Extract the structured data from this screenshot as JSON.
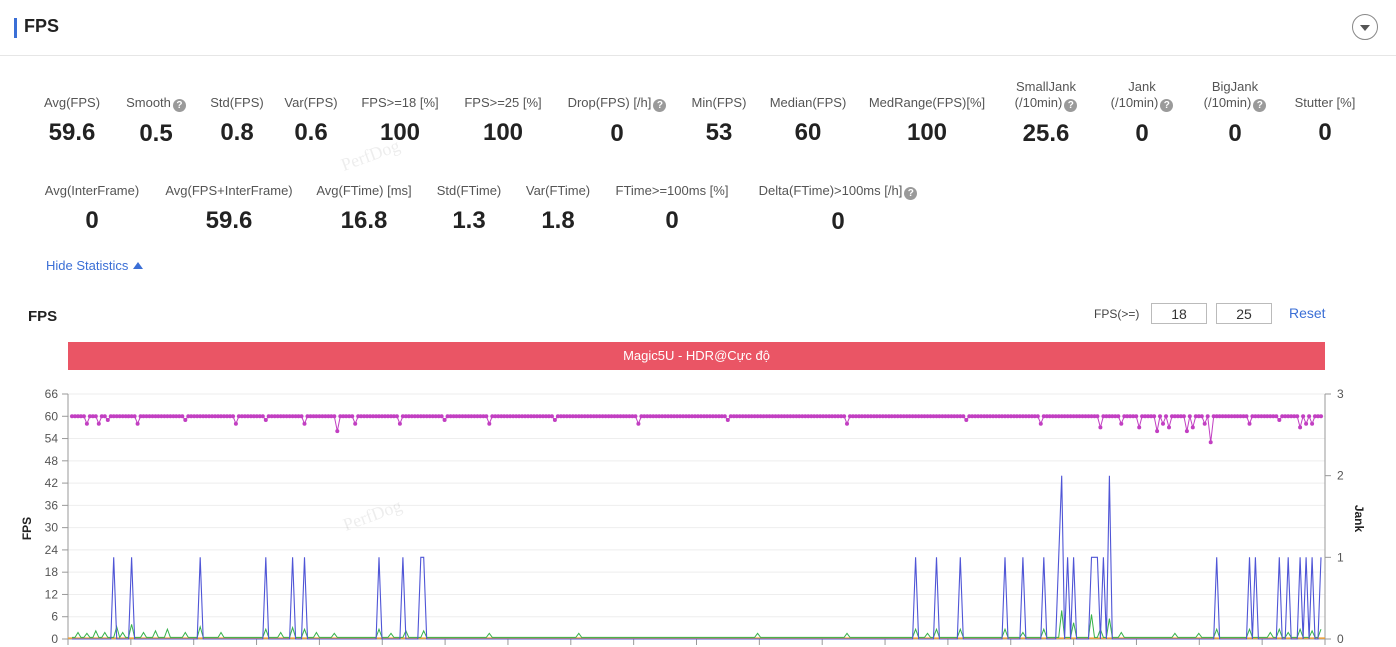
{
  "header": {
    "title": "FPS"
  },
  "stats_row1": [
    {
      "label": "Avg(FPS)",
      "value": "59.6",
      "help": false
    },
    {
      "label": "Smooth",
      "value": "0.5",
      "help": true
    },
    {
      "label": "Std(FPS)",
      "value": "0.8",
      "help": false
    },
    {
      "label": "Var(FPS)",
      "value": "0.6",
      "help": false
    },
    {
      "label": "FPS>=18 [%]",
      "value": "100",
      "help": false
    },
    {
      "label": "FPS>=25 [%]",
      "value": "100",
      "help": false
    },
    {
      "label": "Drop(FPS) [/h]",
      "value": "0",
      "help": true
    },
    {
      "label": "Min(FPS)",
      "value": "53",
      "help": false
    },
    {
      "label": "Median(FPS)",
      "value": "60",
      "help": false
    },
    {
      "label": "MedRange(FPS)[%]",
      "value": "100",
      "help": false
    },
    {
      "label": "SmallJank",
      "label2": "(/10min)",
      "value": "25.6",
      "help": true
    },
    {
      "label": "Jank",
      "label2": "(/10min)",
      "value": "0",
      "help": true
    },
    {
      "label": "BigJank",
      "label2": "(/10min)",
      "value": "0",
      "help": true
    },
    {
      "label": "Stutter [%]",
      "value": "0",
      "help": false
    }
  ],
  "stats_row2": [
    {
      "label": "Avg(InterFrame)",
      "value": "0",
      "help": false
    },
    {
      "label": "Avg(FPS+InterFrame)",
      "value": "59.6",
      "help": false
    },
    {
      "label": "Avg(FTime) [ms]",
      "value": "16.8",
      "help": false
    },
    {
      "label": "Std(FTime)",
      "value": "1.3",
      "help": false
    },
    {
      "label": "Var(FTime)",
      "value": "1.8",
      "help": false
    },
    {
      "label": "FTime>=100ms [%]",
      "value": "0",
      "help": false
    },
    {
      "label": "Delta(FTime)>100ms [/h]",
      "value": "0",
      "help": true
    }
  ],
  "hide_statistics_label": "Hide Statistics",
  "chart_section": {
    "title": "FPS",
    "threshold_label": "FPS(>=)",
    "threshold_low": "18",
    "threshold_high": "25",
    "reset_label": "Reset",
    "device_label": "Magic5U - HDR@Cực độ"
  },
  "watermark": "PerfDog",
  "colors": {
    "accent": "#3b6fd6",
    "device_bar": "#ea5565",
    "fps_series": "#c23fc2",
    "jank_series": "#4f55d6",
    "small_jank_series": "#36b24a",
    "baseline_series": "#f0a23a"
  },
  "chart_data": {
    "type": "line",
    "x_tick_count": 21,
    "y_left": {
      "label": "FPS",
      "ticks": [
        0,
        6,
        12,
        18,
        24,
        30,
        36,
        42,
        48,
        54,
        60,
        66
      ],
      "ylim": [
        0,
        66
      ]
    },
    "y_right": {
      "label": "Jank",
      "ticks": [
        0,
        1,
        2,
        3
      ],
      "ylim": [
        0,
        3
      ]
    },
    "series": [
      {
        "key": "fps",
        "axis": "left",
        "style": "dots",
        "points": 420,
        "baseline": 60,
        "dips": [
          {
            "i": 5,
            "v": 58
          },
          {
            "i": 9,
            "v": 58
          },
          {
            "i": 12,
            "v": 59
          },
          {
            "i": 22,
            "v": 58
          },
          {
            "i": 38,
            "v": 59
          },
          {
            "i": 55,
            "v": 58
          },
          {
            "i": 65,
            "v": 59
          },
          {
            "i": 78,
            "v": 58
          },
          {
            "i": 89,
            "v": 56
          },
          {
            "i": 95,
            "v": 58
          },
          {
            "i": 110,
            "v": 58
          },
          {
            "i": 125,
            "v": 59
          },
          {
            "i": 140,
            "v": 58
          },
          {
            "i": 162,
            "v": 59
          },
          {
            "i": 190,
            "v": 58
          },
          {
            "i": 220,
            "v": 59
          },
          {
            "i": 260,
            "v": 58
          },
          {
            "i": 300,
            "v": 59
          },
          {
            "i": 325,
            "v": 58
          },
          {
            "i": 345,
            "v": 57
          },
          {
            "i": 352,
            "v": 58
          },
          {
            "i": 358,
            "v": 57
          },
          {
            "i": 364,
            "v": 56
          },
          {
            "i": 366,
            "v": 58
          },
          {
            "i": 368,
            "v": 57
          },
          {
            "i": 374,
            "v": 56
          },
          {
            "i": 376,
            "v": 57
          },
          {
            "i": 380,
            "v": 58
          },
          {
            "i": 382,
            "v": 53
          },
          {
            "i": 395,
            "v": 58
          },
          {
            "i": 405,
            "v": 59
          },
          {
            "i": 412,
            "v": 57
          },
          {
            "i": 414,
            "v": 58
          },
          {
            "i": 416,
            "v": 58
          }
        ]
      },
      {
        "key": "jank",
        "axis": "right",
        "style": "spikes",
        "points": 420,
        "spikes": [
          {
            "i": 14,
            "v": 1
          },
          {
            "i": 20,
            "v": 1
          },
          {
            "i": 43,
            "v": 1
          },
          {
            "i": 65,
            "v": 1
          },
          {
            "i": 74,
            "v": 1
          },
          {
            "i": 78,
            "v": 1
          },
          {
            "i": 103,
            "v": 1
          },
          {
            "i": 111,
            "v": 1
          },
          {
            "i": 117,
            "v": 1
          },
          {
            "i": 118,
            "v": 1
          },
          {
            "i": 283,
            "v": 1
          },
          {
            "i": 290,
            "v": 1
          },
          {
            "i": 298,
            "v": 1
          },
          {
            "i": 313,
            "v": 1
          },
          {
            "i": 319,
            "v": 1
          },
          {
            "i": 326,
            "v": 1
          },
          {
            "i": 331,
            "v": 1
          },
          {
            "i": 332,
            "v": 2
          },
          {
            "i": 334,
            "v": 1
          },
          {
            "i": 336,
            "v": 1
          },
          {
            "i": 342,
            "v": 1
          },
          {
            "i": 343,
            "v": 1
          },
          {
            "i": 344,
            "v": 1
          },
          {
            "i": 346,
            "v": 1
          },
          {
            "i": 348,
            "v": 2
          },
          {
            "i": 384,
            "v": 1
          },
          {
            "i": 395,
            "v": 1
          },
          {
            "i": 397,
            "v": 1
          },
          {
            "i": 405,
            "v": 1
          },
          {
            "i": 408,
            "v": 1
          },
          {
            "i": 412,
            "v": 1
          },
          {
            "i": 414,
            "v": 1
          },
          {
            "i": 416,
            "v": 1
          },
          {
            "i": 419,
            "v": 1
          }
        ]
      },
      {
        "key": "small_jank",
        "axis": "right",
        "style": "line",
        "points": 420,
        "bumps": [
          {
            "i": 2,
            "v": 0.08
          },
          {
            "i": 5,
            "v": 0.07
          },
          {
            "i": 8,
            "v": 0.1
          },
          {
            "i": 11,
            "v": 0.08
          },
          {
            "i": 15,
            "v": 0.15
          },
          {
            "i": 17,
            "v": 0.08
          },
          {
            "i": 20,
            "v": 0.18
          },
          {
            "i": 24,
            "v": 0.08
          },
          {
            "i": 28,
            "v": 0.1
          },
          {
            "i": 32,
            "v": 0.12
          },
          {
            "i": 38,
            "v": 0.08
          },
          {
            "i": 43,
            "v": 0.15
          },
          {
            "i": 50,
            "v": 0.08
          },
          {
            "i": 65,
            "v": 0.12
          },
          {
            "i": 70,
            "v": 0.08
          },
          {
            "i": 74,
            "v": 0.14
          },
          {
            "i": 78,
            "v": 0.12
          },
          {
            "i": 82,
            "v": 0.08
          },
          {
            "i": 88,
            "v": 0.07
          },
          {
            "i": 103,
            "v": 0.12
          },
          {
            "i": 107,
            "v": 0.07
          },
          {
            "i": 112,
            "v": 0.1
          },
          {
            "i": 118,
            "v": 0.1
          },
          {
            "i": 140,
            "v": 0.07
          },
          {
            "i": 170,
            "v": 0.07
          },
          {
            "i": 230,
            "v": 0.07
          },
          {
            "i": 260,
            "v": 0.07
          },
          {
            "i": 283,
            "v": 0.12
          },
          {
            "i": 287,
            "v": 0.07
          },
          {
            "i": 290,
            "v": 0.12
          },
          {
            "i": 298,
            "v": 0.12
          },
          {
            "i": 313,
            "v": 0.12
          },
          {
            "i": 319,
            "v": 0.08
          },
          {
            "i": 326,
            "v": 0.12
          },
          {
            "i": 332,
            "v": 0.35
          },
          {
            "i": 336,
            "v": 0.2
          },
          {
            "i": 342,
            "v": 0.3
          },
          {
            "i": 345,
            "v": 0.12
          },
          {
            "i": 348,
            "v": 0.25
          },
          {
            "i": 352,
            "v": 0.08
          },
          {
            "i": 370,
            "v": 0.07
          },
          {
            "i": 378,
            "v": 0.07
          },
          {
            "i": 384,
            "v": 0.12
          },
          {
            "i": 395,
            "v": 0.12
          },
          {
            "i": 402,
            "v": 0.08
          },
          {
            "i": 405,
            "v": 0.12
          },
          {
            "i": 408,
            "v": 0.08
          },
          {
            "i": 412,
            "v": 0.12
          },
          {
            "i": 416,
            "v": 0.1
          },
          {
            "i": 419,
            "v": 0.12
          }
        ]
      },
      {
        "key": "baseline",
        "axis": "right",
        "style": "flat",
        "value": 0.01
      }
    ]
  }
}
